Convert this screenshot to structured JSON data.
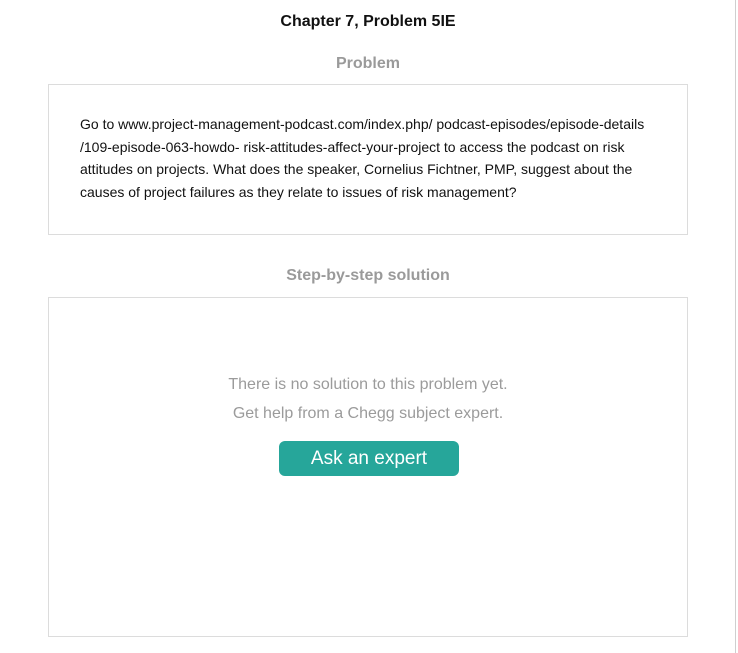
{
  "page": {
    "title": "Chapter 7, Problem 5IE"
  },
  "problem": {
    "heading": "Problem",
    "lines": [
      "Go to www.project-management-podcast.com/index.php/ podcast-episodes/episode-details",
      "/109-episode-063-howdo- risk-attitudes-affect-your-project to access the podcast on risk",
      "attitudes on projects. What does the speaker, Cornelius Fichtner, PMP, suggest about the",
      "causes of project failures as they relate to issues of risk management?"
    ]
  },
  "solution": {
    "heading": "Step-by-step solution",
    "empty_line_1": "There is no solution to this problem yet.",
    "empty_line_2": "Get help from a Chegg subject expert.",
    "button_label": "Ask an expert"
  },
  "colors": {
    "accent": "#26a69a",
    "muted_text": "#9b9b9b",
    "border": "#dcdcdc"
  }
}
